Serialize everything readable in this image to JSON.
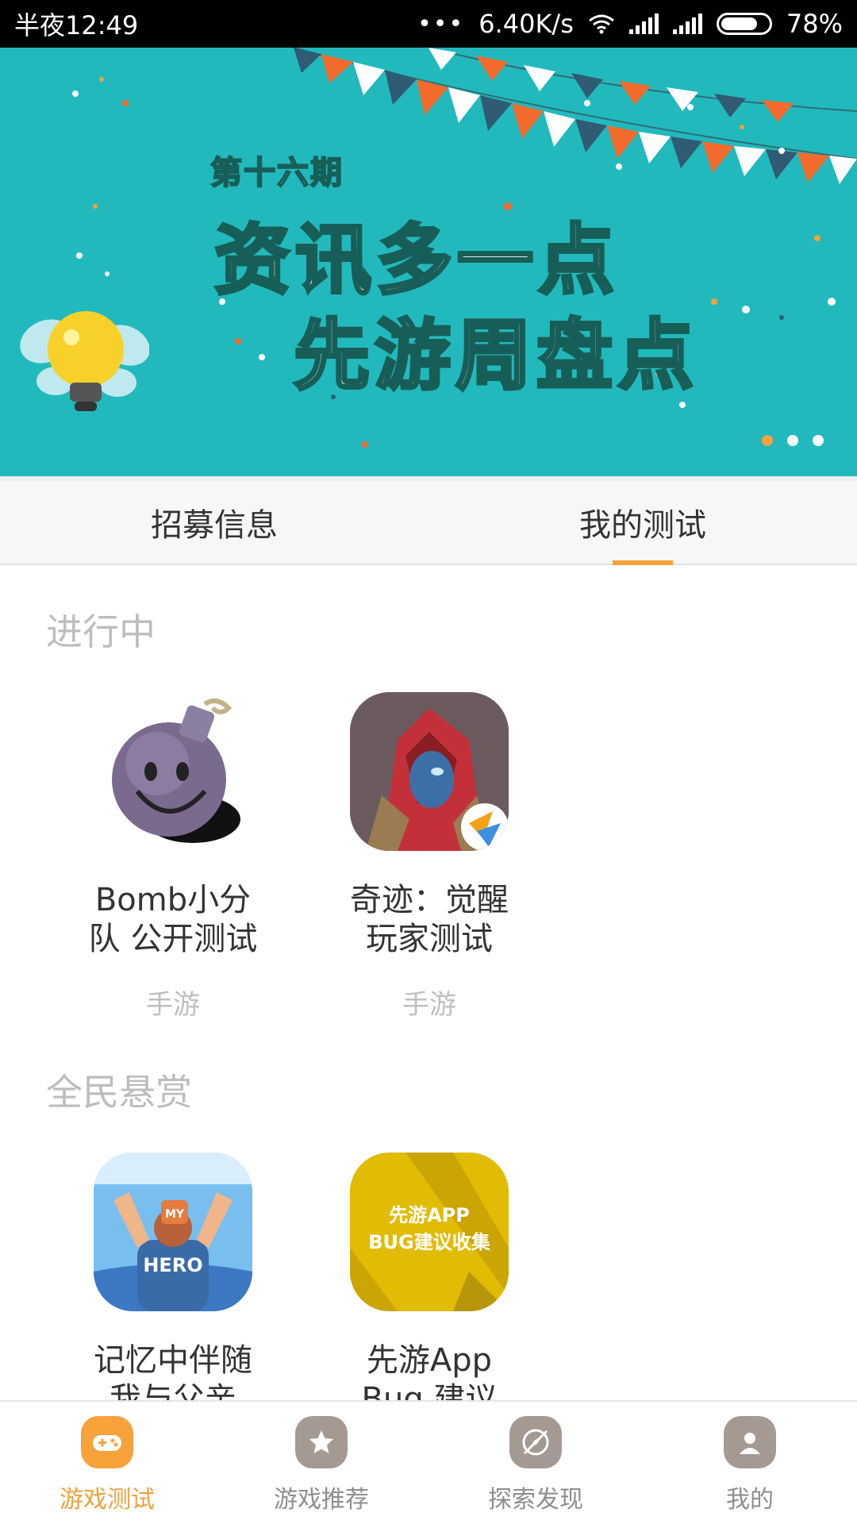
{
  "status_bar": {
    "time": "半夜12:49",
    "dots": "•••",
    "network_speed": "6.40K/s",
    "battery": "78%",
    "battery_level": 0.78
  },
  "banner": {
    "kicker": "第十六期",
    "line1": "资讯多一点",
    "line2": "先游周盘点",
    "page_count": 3,
    "active_page": 1,
    "background_color": "#22b9bd"
  },
  "tabs": [
    {
      "label": "招募信息",
      "active": false
    },
    {
      "label": "我的测试",
      "active": true
    }
  ],
  "sections": [
    {
      "title": "进行中",
      "items": [
        {
          "name": "Bomb小分队 公开测试",
          "type": "手游",
          "icon": "bomb-game-icon"
        },
        {
          "name": "奇迹：觉醒玩家测试",
          "type": "手游",
          "icon": "miracle-awakening-game-icon"
        }
      ]
    },
    {
      "title": "全民悬赏",
      "items": [
        {
          "name": "记忆中伴随我与父亲",
          "icon": "my-hero-game-icon"
        },
        {
          "name": "先游App Bug 建议",
          "icon": "xianyou-bug-feedback-icon",
          "icon_text": "先游APP\nBUG建议收集"
        }
      ]
    }
  ],
  "bottom_nav": [
    {
      "label": "游戏测试",
      "icon": "gamepad-icon",
      "active": true
    },
    {
      "label": "游戏推荐",
      "icon": "star-icon",
      "active": false
    },
    {
      "label": "探索发现",
      "icon": "compass-icon",
      "active": false
    },
    {
      "label": "我的",
      "icon": "user-icon",
      "active": false
    }
  ],
  "colors": {
    "accent": "#f6a23b",
    "banner_teal": "#22b9bd",
    "inactive_nav": "#a49a93"
  }
}
